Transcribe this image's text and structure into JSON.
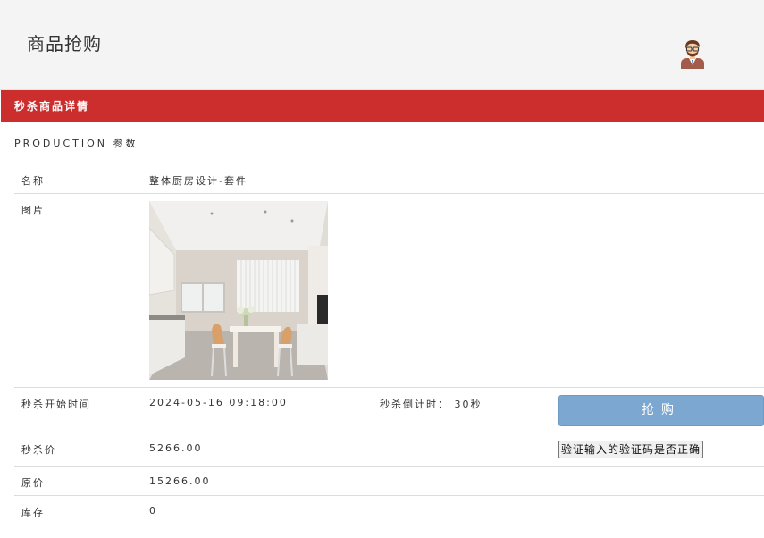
{
  "header": {
    "title": "商品抢购",
    "avatar_icon": "user-avatar-icon"
  },
  "panel": {
    "heading": "秒杀商品详情",
    "section_title": "PRODUCTION 参数",
    "accent_color": "#cc2d2d"
  },
  "product": {
    "name_label": "名称",
    "name_value": "整体厨房设计-套件",
    "image_label": "图片",
    "start_label": "秒杀开始时间",
    "start_value": "2024-05-16 09:18:00",
    "countdown_text": "秒杀倒计时： 30秒",
    "buy_button": "抢购",
    "price_label": "秒杀价",
    "price_value": "5266.00",
    "verify_button": "验证输入的验证码是否正确",
    "original_label": "原价",
    "original_value": "15266.00",
    "stock_label": "库存",
    "stock_value": "0"
  }
}
